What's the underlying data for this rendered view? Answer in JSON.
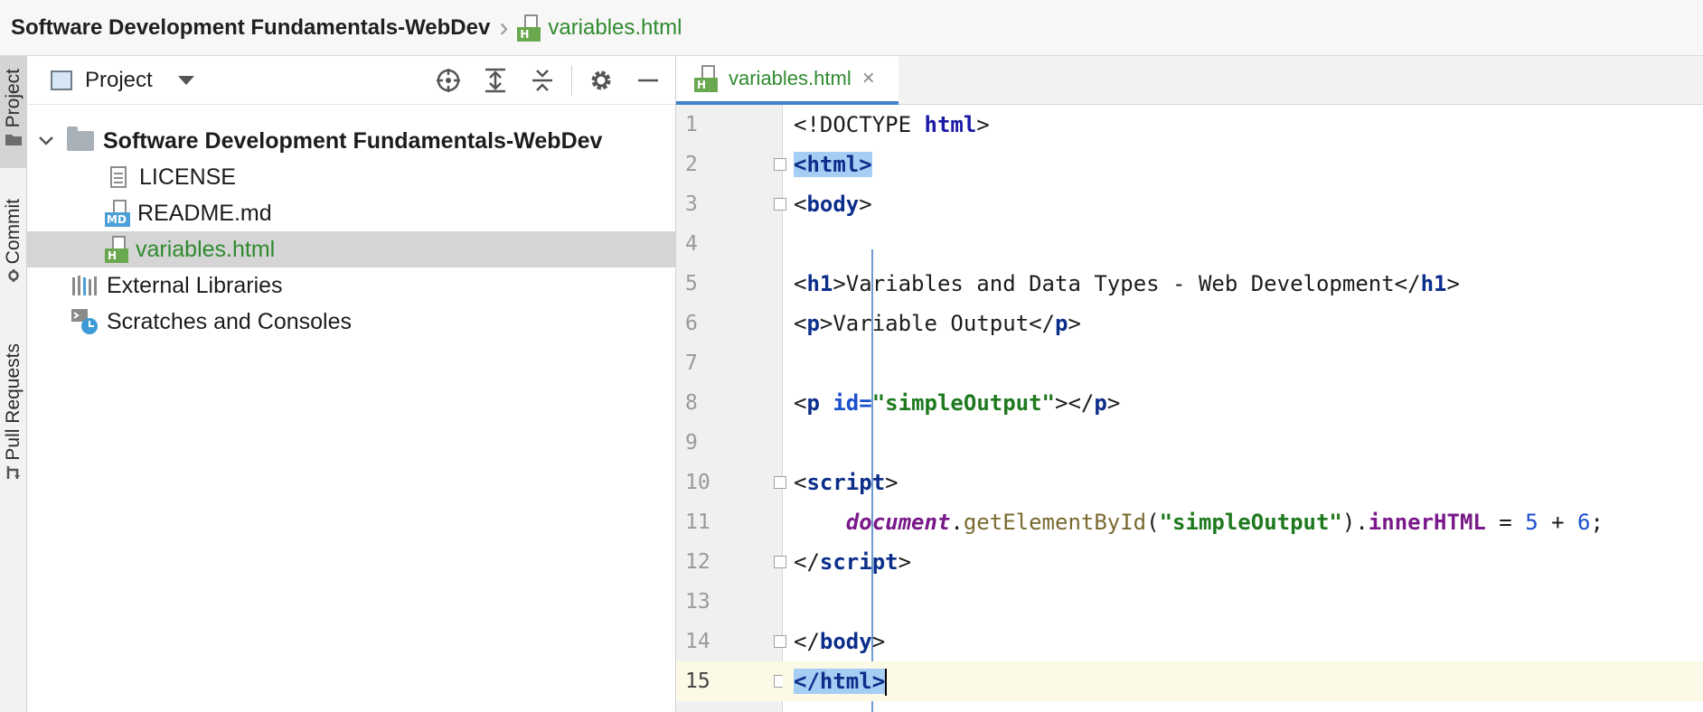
{
  "breadcrumb": {
    "project": "Software Development Fundamentals-WebDev",
    "file": "variables.html"
  },
  "toolstrip": {
    "tabs": [
      "Project",
      "Commit",
      "Pull Requests"
    ]
  },
  "project_panel": {
    "title": "Project",
    "tree": [
      {
        "label": "Software Development Fundamentals-WebDev",
        "type": "folder",
        "expanded": true
      },
      {
        "label": "LICENSE",
        "type": "file"
      },
      {
        "label": "README.md",
        "type": "markdown"
      },
      {
        "label": "variables.html",
        "type": "html",
        "selected": true
      },
      {
        "label": "External Libraries",
        "type": "libraries"
      },
      {
        "label": "Scratches and Consoles",
        "type": "scratches"
      }
    ]
  },
  "editor": {
    "tab_label": "variables.html",
    "tab_close": "×",
    "current_line": 15,
    "line_numbers": [
      "1",
      "2",
      "3",
      "4",
      "5",
      "6",
      "7",
      "8",
      "9",
      "10",
      "11",
      "12",
      "13",
      "14",
      "15"
    ],
    "code": {
      "l1_a": "<!DOCTYPE ",
      "l1_b": "html",
      "l1_c": ">",
      "l2": "<html>",
      "l3_a": "<",
      "l3_b": "body",
      "l3_c": ">",
      "l5_a": "<",
      "l5_b": "h1",
      "l5_c": ">Variables and Data Types - Web Development</",
      "l5_d": "h1",
      "l5_e": ">",
      "l6_a": "<",
      "l6_b": "p",
      "l6_c": ">Variable Output</",
      "l6_d": "p",
      "l6_e": ">",
      "l8_a": "<",
      "l8_b": "p ",
      "l8_c": "id=",
      "l8_d": "\"simpleOutput\"",
      "l8_e": "></",
      "l8_f": "p",
      "l8_g": ">",
      "l10_a": "<",
      "l10_b": "script",
      "l10_c": ">",
      "l11_indent": "    ",
      "l11_a": "document",
      "l11_b": ".",
      "l11_c": "getElementById",
      "l11_d": "(",
      "l11_e": "\"simpleOutput\"",
      "l11_f": ").",
      "l11_g": "innerHTML",
      "l11_h": " = ",
      "l11_i": "5",
      "l11_j": " + ",
      "l11_k": "6",
      "l11_l": ";",
      "l12_a": "</",
      "l12_b": "script",
      "l12_c": ">",
      "l14_a": "</",
      "l14_b": "body",
      "l14_c": ">",
      "l15": "</html>"
    }
  }
}
